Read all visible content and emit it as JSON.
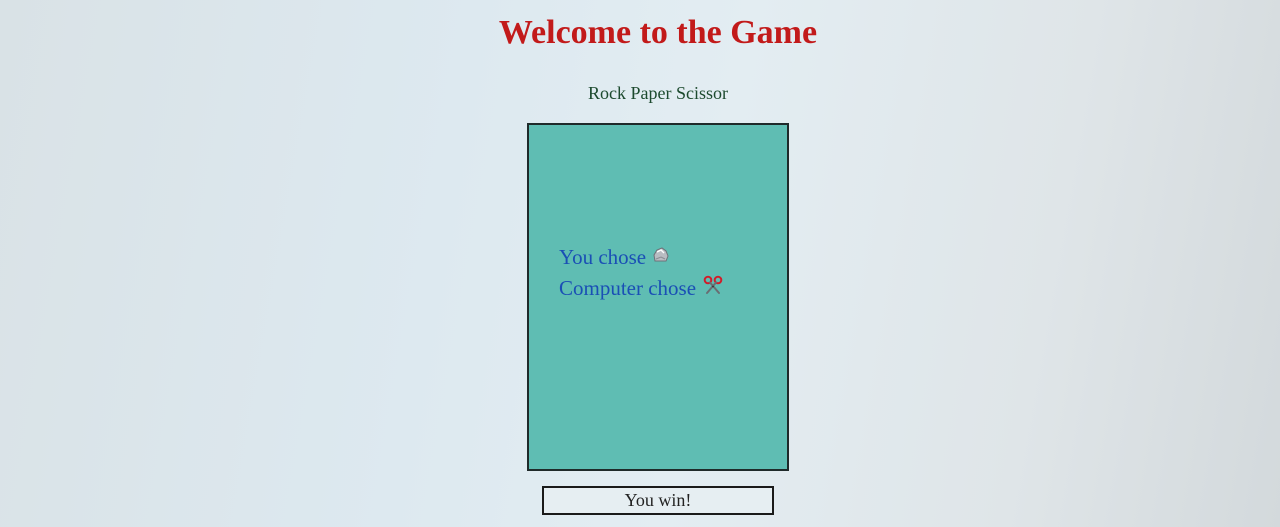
{
  "header": {
    "title": "Welcome to the Game",
    "subtitle": "Rock Paper Scissor"
  },
  "game": {
    "player_label": "You chose",
    "player_choice_icon": "rock-icon",
    "computer_label": "Computer chose",
    "computer_choice_icon": "scissors-icon",
    "panel_color": "#5fbdb3"
  },
  "result": {
    "text": "You win!"
  },
  "colors": {
    "title": "#c21a1a",
    "subtitle": "#1c4a2e",
    "choice_text": "#1a4fb5"
  }
}
